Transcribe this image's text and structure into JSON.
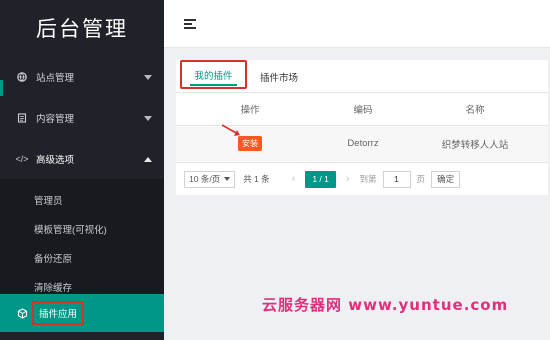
{
  "sidebar": {
    "logo": "后台管理",
    "items": [
      {
        "label": "站点管理",
        "icon": "globe-icon"
      },
      {
        "label": "内容管理",
        "icon": "document-icon"
      },
      {
        "label": "高级选项",
        "icon": "code-icon"
      }
    ],
    "submenu": [
      "管理员",
      "模板管理(可视化)",
      "备份还原",
      "清除缓存"
    ],
    "active": {
      "label": "插件应用",
      "icon": "cube-icon"
    }
  },
  "tabs": [
    "我的插件",
    "插件市场"
  ],
  "table": {
    "headers": [
      "操作",
      "编码",
      "名称"
    ],
    "rows": [
      {
        "action": "安装",
        "code": "Detorrz",
        "name": "织梦转移人人站"
      }
    ]
  },
  "pager": {
    "page_size": "10 条/页",
    "total": "共 1 条",
    "prev": "‹",
    "current": "1 / 1",
    "next": "›",
    "goto_label": "到第",
    "goto_value": "1",
    "page_unit": "页",
    "confirm": "确定"
  },
  "watermark": "云服务器网 www.yuntue.com",
  "colors": {
    "accent": "#009688",
    "highlight": "#d9302a",
    "install": "#ff5722"
  }
}
